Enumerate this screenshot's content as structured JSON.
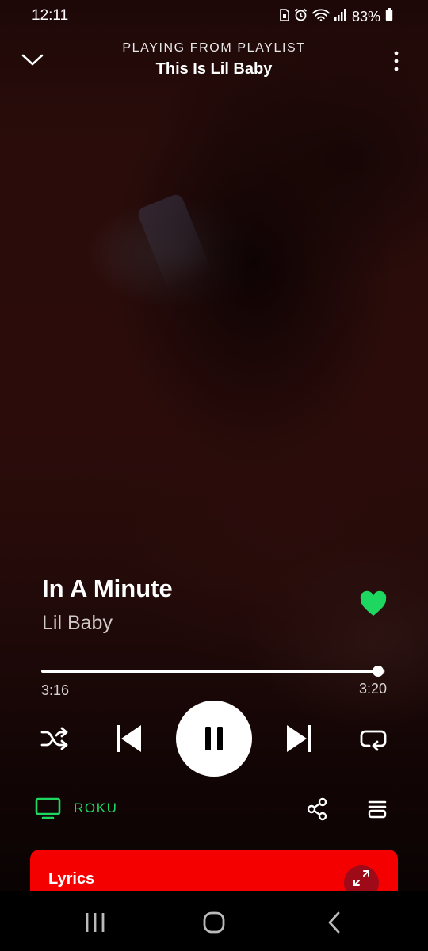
{
  "status_bar": {
    "time": "12:11",
    "battery_percent": "83%",
    "icons": [
      "sim-icon",
      "alarm-icon",
      "wifi-icon",
      "signal-icon",
      "battery-icon"
    ]
  },
  "header": {
    "context_label": "PLAYING FROM PLAYLIST",
    "playlist_name": "This Is Lil Baby",
    "icons": [
      "chevron-down-icon",
      "more-vertical-icon"
    ]
  },
  "track": {
    "title": "In A Minute",
    "artist": "Lil Baby",
    "liked": true,
    "like_color": "#1ed760"
  },
  "playback": {
    "elapsed": "3:16",
    "duration": "3:20",
    "progress_fraction": 0.98,
    "state": "playing",
    "icons": [
      "shuffle-icon",
      "previous-icon",
      "pause-icon",
      "next-icon",
      "repeat-icon"
    ]
  },
  "device": {
    "name": "ROKU",
    "icon": "tv-icon",
    "color": "#1ed760"
  },
  "actions": {
    "icons": [
      "share-icon",
      "queue-icon"
    ]
  },
  "lyrics": {
    "label": "Lyrics",
    "card_color": "#f50000",
    "icon": "expand-icon"
  },
  "nav_bar": {
    "icons": [
      "recent-apps-icon",
      "home-icon",
      "back-icon"
    ]
  }
}
